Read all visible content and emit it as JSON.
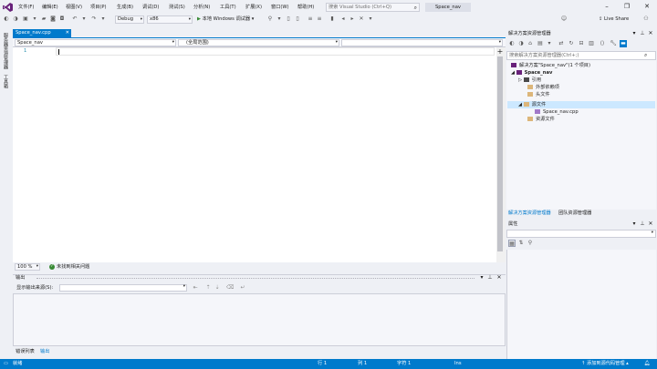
{
  "menu": {
    "items": [
      "文件(F)",
      "编辑(E)",
      "视图(V)",
      "项目(P)",
      "生成(B)",
      "调试(D)",
      "测试(S)",
      "分析(N)",
      "工具(T)",
      "扩展(X)",
      "窗口(W)",
      "帮助(H)"
    ],
    "search_placeholder": "搜索 Visual Studio (Ctrl+Q)",
    "solution_name": "Space_nav"
  },
  "toolbar": {
    "config": "Debug",
    "platform": "x86",
    "run_label": "本地 Windows 调试器",
    "live_share": "Live Share"
  },
  "left_strip": {
    "tabs": [
      "服务器资源管理器",
      "工具箱"
    ]
  },
  "editor": {
    "tab_label": "Space_nav.cpp",
    "nav_project": "Space_nav",
    "nav_scope": "(全局范围)",
    "nav_member": "",
    "line_number": "1",
    "zoom": "100 %",
    "issues_text": "未找到相关问题"
  },
  "output": {
    "title": "输出",
    "source_label": "显示输出来源(S):",
    "bottom_tabs": [
      "错误列表",
      "输出"
    ]
  },
  "solution_explorer": {
    "title": "解决方案资源管理器",
    "search_placeholder": "搜索解决方案资源管理器(Ctrl+;)",
    "tree": [
      {
        "label": "解决方案\"Space_nav\"(1 个项目)"
      },
      {
        "label": "Space_nav"
      },
      {
        "label": "引用"
      },
      {
        "label": "外部依赖项"
      },
      {
        "label": "头文件"
      },
      {
        "label": "源文件"
      },
      {
        "label": "Space_nav.cpp"
      },
      {
        "label": "资源文件"
      }
    ],
    "tabs": [
      "解决方案资源管理器",
      "团队资源管理器"
    ]
  },
  "properties": {
    "title": "属性"
  },
  "statusbar": {
    "ready": "就绪",
    "line": "行 1",
    "col": "列 1",
    "char": "字符 1",
    "ins": "Ins",
    "source_control": "添加到源代码管理"
  },
  "colors": {
    "accent": "#007acc",
    "background": "#eef0f5",
    "vs_purple": "#68217a"
  }
}
